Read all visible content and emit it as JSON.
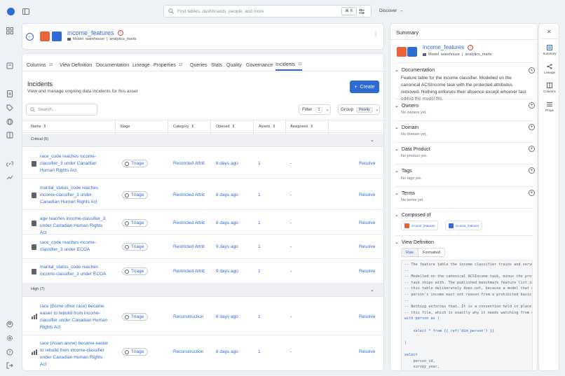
{
  "topbar": {
    "search_placeholder": "Find tables, dashboards, people, and more",
    "kbd": "⌘ K",
    "discover": "Discover"
  },
  "asset": {
    "name": "income_features",
    "type": "Model",
    "database": "warehouse",
    "schema": "analytics_marts"
  },
  "tabs": [
    {
      "label": "Columns",
      "count": "15"
    },
    {
      "label": "View Definition",
      "count": ""
    },
    {
      "label": "Documentation",
      "count": ""
    },
    {
      "label": "Lineage",
      "count": ""
    },
    {
      "label": "Properties",
      "count": "12"
    },
    {
      "label": "Queries",
      "count": ""
    },
    {
      "label": "Stats",
      "count": ""
    },
    {
      "label": "Quality",
      "count": ""
    },
    {
      "label": "Governance",
      "count": ""
    },
    {
      "label": "Incidents",
      "count": "12"
    }
  ],
  "incidents": {
    "title": "Incidents",
    "subtitle": "View and manage ongoing data incidents for this asset",
    "create": "Create",
    "search_placeholder": "Search...",
    "filter_label": "Filter",
    "filter_count": "1",
    "group_label": "Group",
    "group_value": "Priority",
    "columns": [
      "Name",
      "Stage",
      "Category",
      "Opened",
      "Assets",
      "Assignees"
    ],
    "groups": [
      {
        "label": "Critical (5)",
        "rows": [
          {
            "name": "race_code reaches income-classifier_3 under Canadian Human Rights Act",
            "stage": "Triage",
            "category": "Restricted Attribute",
            "opened": "8 days ago",
            "assets": "1",
            "assignees": "-",
            "action": "Resolve"
          },
          {
            "name": "marital_status_code reaches income-classifier_3 under Canadian Human Rights Act",
            "stage": "Triage",
            "category": "Restricted Attribute",
            "opened": "8 days ago",
            "assets": "1",
            "assignees": "-",
            "action": "Resolve"
          },
          {
            "name": "age reaches income-classifier_3 under Canadian Human Rights Act",
            "stage": "Triage",
            "category": "Restricted Attribute",
            "opened": "8 days ago",
            "assets": "1",
            "assignees": "-",
            "action": "Resolve"
          },
          {
            "name": "race_code reaches income-classifier_3 under ECOA",
            "stage": "Triage",
            "category": "Restricted Attribute",
            "opened": "9 days ago",
            "assets": "1",
            "assignees": "-",
            "action": "Resolve"
          },
          {
            "name": "marital_status_code reaches income-classifier_3 under ECOA",
            "stage": "Triage",
            "category": "Restricted Attribute",
            "opened": "9 days ago",
            "assets": "1",
            "assignees": "-",
            "action": "Resolve"
          }
        ]
      },
      {
        "label": "High (7)",
        "rows": [
          {
            "name": "race (Some other race) became easier to rebuild from income-classifier under Canadian Human Rights Act",
            "stage": "Triage",
            "category": "Reconstruction",
            "opened": "8 days ago",
            "assets": "1",
            "assignees": "-",
            "action": "Resolve"
          },
          {
            "name": "race (Asian alone) became easier to rebuild from income-classifier under Canadian Human Rights Act",
            "stage": "Triage",
            "category": "Reconstruction",
            "opened": "8 days ago",
            "assets": "1",
            "assignees": "-",
            "action": "Resolve"
          }
        ]
      }
    ]
  },
  "summary": {
    "title": "Summary",
    "documentation_label": "Documentation",
    "documentation": "Feature table for the income classifier. Modelled on the canonical ACSIncome task with the protected attributes removed. Nothing enforces their absence except whoever last edited the model file.",
    "owners_label": "Owners",
    "owners_empty": "No owners yet.",
    "domain_label": "Domain",
    "domain_empty": "No domain yet.",
    "product_label": "Data Product",
    "product_empty": "No product yet.",
    "tags_label": "Tags",
    "tags_empty": "No tags yet.",
    "terms_label": "Terms",
    "terms_empty": "No terms yet.",
    "composed_label": "Composed of",
    "composed": [
      "income_features",
      "income_features"
    ],
    "viewdef_label": "View Definition",
    "raw": "Raw",
    "formatted": "Formatted"
  },
  "code_lines": [
    "-- The feature table the income classifier trains and serves on.",
    "--",
    "-- Modelled on the canonical ACSIncome task, minus the protected attributes",
    "-- task ships with. The published benchmark feature list includes",
    "-- this table deliberately does not, because a model that decides",
    "-- person's income must not reason from a prohibited basis.",
    "--",
    "-- Nothing enforces that. It is a convention held in place by",
    "-- this file, which is exactly why it needs watching from outside.",
    "with person as (",
    "",
    "    select * from {{ ref('dim_person') }}",
    "",
    ")",
    "",
    "select",
    "    person_id,",
    "    survey_year,"
  ],
  "rail": [
    "Summary",
    "Lineage",
    "Columns",
    "Props"
  ]
}
